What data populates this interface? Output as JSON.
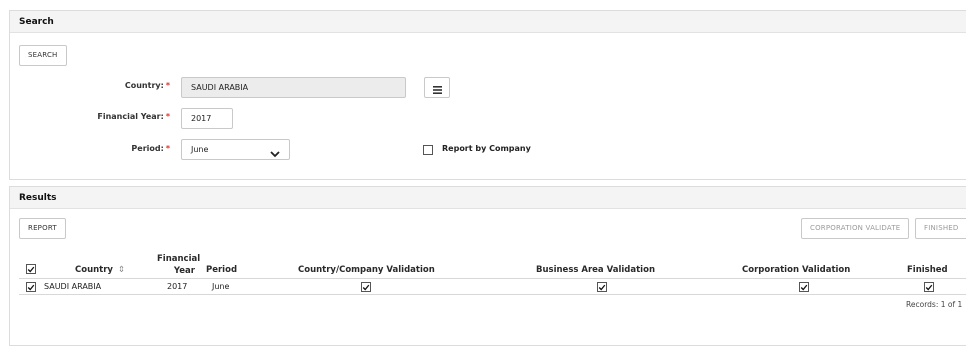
{
  "search_panel": {
    "title": "Search",
    "search_button": "SEARCH",
    "country_label": "Country:",
    "country_value": "SAUDI ARABIA",
    "financial_year_label": "Financial Year:",
    "financial_year_value": "2017",
    "period_label": "Period:",
    "period_value": "June",
    "required_mark": "*",
    "report_by_company_label": "Report by Company",
    "report_by_company_checked": false
  },
  "results_panel": {
    "title": "Results",
    "report_button": "REPORT",
    "corporation_validate_button": "CORPORATION VALIDATE",
    "finished_button": "FINISHED",
    "columns": {
      "country": "Country",
      "financial_year_line1": "Financial",
      "financial_year_line2": "Year",
      "period": "Period",
      "country_company_validation": "Country/Company Validation",
      "business_area_validation": "Business Area Validation",
      "corporation_validation": "Corporation Validation",
      "finished": "Finished"
    },
    "sort_icon": "⇕",
    "rows": [
      {
        "selected": true,
        "country": "SAUDI ARABIA",
        "financial_year": "2017",
        "period": "June",
        "country_company_validation": true,
        "business_area_validation": true,
        "corporation_validation": true,
        "finished": true
      }
    ],
    "records_text": "Records: 1 of 1"
  }
}
